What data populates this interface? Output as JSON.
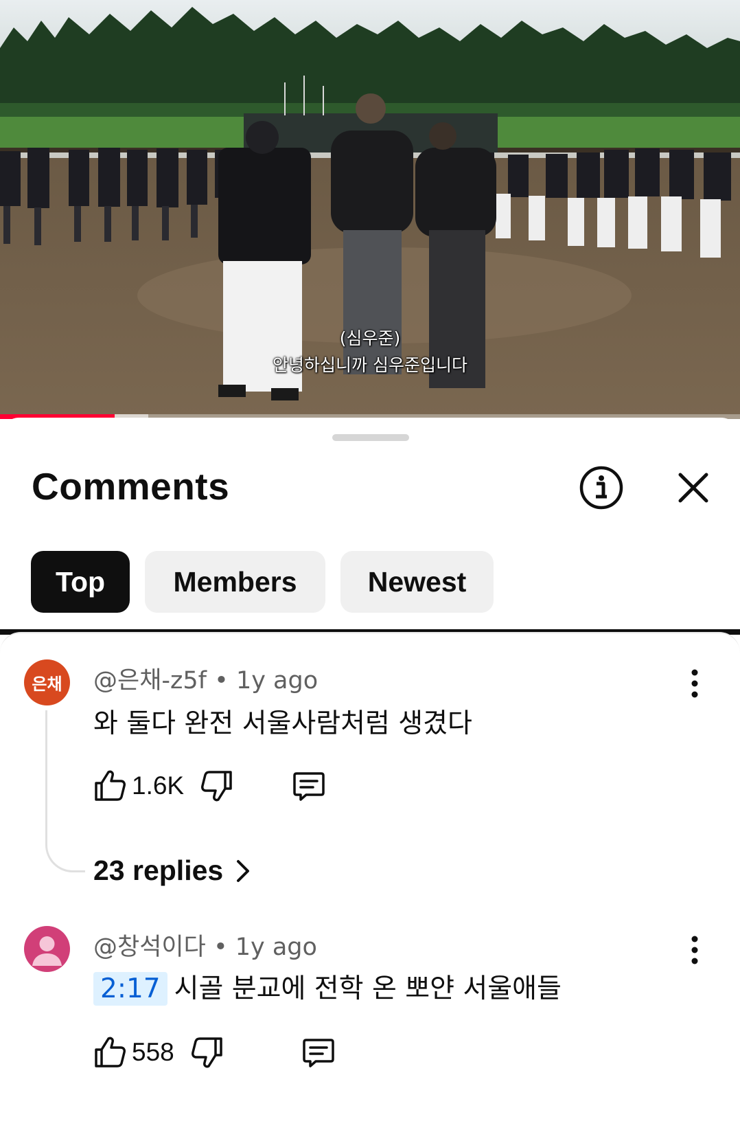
{
  "video": {
    "subtitle_line1": "(심우준)",
    "subtitle_line2": "안녕하십니까 심우준입니다",
    "progress_fraction": 0.155,
    "buffered_fraction": 0.2
  },
  "comments_sheet": {
    "title": "Comments",
    "info_icon": "info-circle-icon",
    "close_icon": "close-icon",
    "filters": [
      {
        "label": "Top",
        "active": true
      },
      {
        "label": "Members",
        "active": false
      },
      {
        "label": "Newest",
        "active": false
      }
    ]
  },
  "comments": [
    {
      "avatar_text": "은채",
      "avatar_color": "#d8491f",
      "author": "@은채-z5f",
      "age": "1y ago",
      "separator": "•",
      "text": "와 둘다 완전 서울사람처럼 생겼다",
      "likes": "1.6K",
      "replies_label": "23 replies"
    },
    {
      "avatar_color": "#d13f78",
      "author": "@창석이다",
      "age": "1y ago",
      "separator": "•",
      "timestamp": "2:17",
      "text": "시골 분교에 전학 온 뽀얀 서울애들",
      "likes": "558"
    }
  ],
  "colors": {
    "accent_red": "#ff0033",
    "timestamp_blue": "#065fd4",
    "timestamp_bg": "#def1ff"
  }
}
